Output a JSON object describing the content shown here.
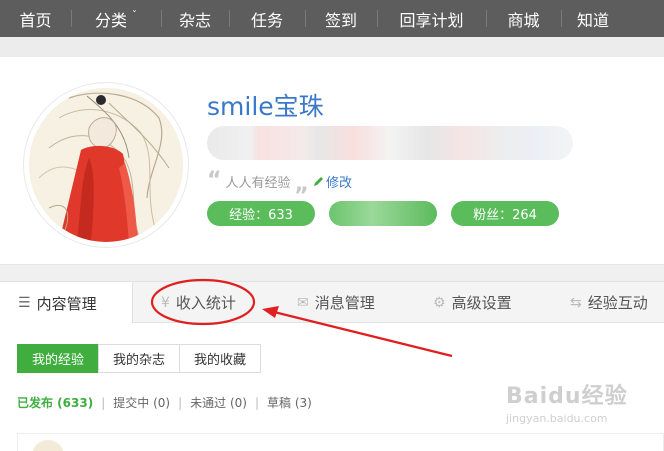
{
  "nav": {
    "items": [
      {
        "label": "首页"
      },
      {
        "label": "分类",
        "has_dropdown": true
      },
      {
        "label": "杂志"
      },
      {
        "label": "任务"
      },
      {
        "label": "签到"
      },
      {
        "label": "回享计划"
      },
      {
        "label": "商城"
      },
      {
        "label": "知道"
      }
    ]
  },
  "profile": {
    "username": "smile宝珠",
    "signature": "人人有经验",
    "edit_label": "修改",
    "badges": {
      "experience": "经验：633",
      "fans": "粉丝：264"
    }
  },
  "tabs": [
    {
      "label": "内容管理",
      "icon": "list-icon",
      "active": true
    },
    {
      "label": "收入统计",
      "icon": "yen-icon"
    },
    {
      "label": "消息管理",
      "icon": "mail-icon"
    },
    {
      "label": "高级设置",
      "icon": "gear-icon"
    },
    {
      "label": "经验互动",
      "icon": "exchange-icon"
    }
  ],
  "subtabs": [
    {
      "label": "我的经验",
      "active": true
    },
    {
      "label": "我的杂志"
    },
    {
      "label": "我的收藏"
    }
  ],
  "filters": {
    "published": "已发布 (633)",
    "submitting": "提交中 (0)",
    "rejected": "未通过 (0)",
    "drafts": "草稿 (3)"
  },
  "watermark": {
    "brand": "Baidu经验",
    "domain": "jingyan.baidu.com"
  },
  "colors": {
    "nav_bg": "#5d5d5d",
    "accent_green": "#3fae3f",
    "badge_green": "#5bbc5b",
    "link_blue": "#3a78c9",
    "annotation_red": "#e02020"
  }
}
